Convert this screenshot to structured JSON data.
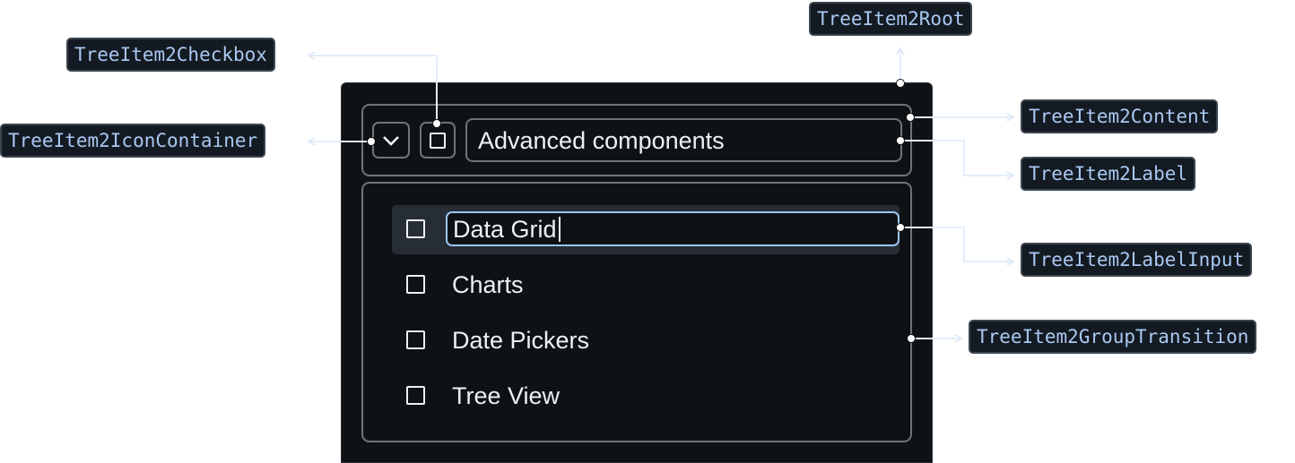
{
  "labels": {
    "root": "TreeItem2Root",
    "checkbox": "TreeItem2Checkbox",
    "icon_container": "TreeItem2IconContainer",
    "content": "TreeItem2Content",
    "label": "TreeItem2Label",
    "label_input": "TreeItem2LabelInput",
    "group_transition": "TreeItem2GroupTransition"
  },
  "tree": {
    "parent_label": "Advanced components",
    "editing_value": "Data Grid",
    "children": [
      "Charts",
      "Date Pickers",
      "Tree View"
    ]
  },
  "icons": {
    "expand": "chevron-down-icon",
    "checkbox": "checkbox-outline-icon"
  },
  "colors": {
    "panel_bg": "#0f1215",
    "callout_bg": "#141a21",
    "callout_text": "#a9c8f2",
    "connector": "#e4eefb",
    "focus_border": "#9cc6f5",
    "selected_row_bg": "#262d35"
  }
}
